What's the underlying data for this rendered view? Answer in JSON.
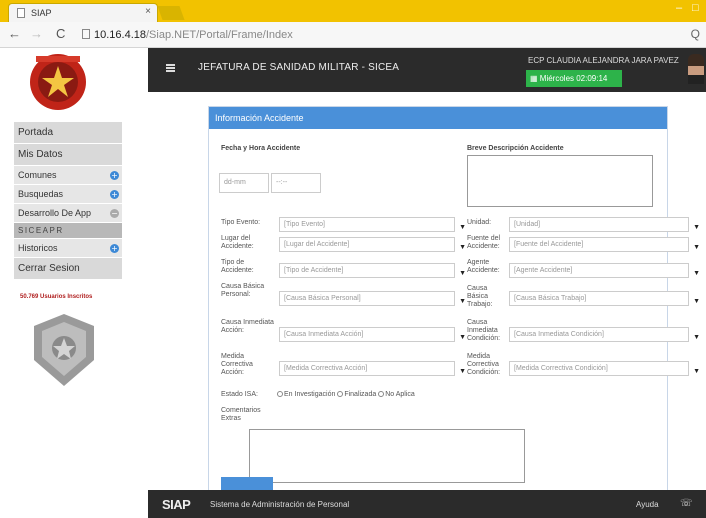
{
  "browser": {
    "tab_title": "SIAP",
    "url_host": "10.16.4.18",
    "url_path": "/Siap.NET/Portal/Frame/Index"
  },
  "header": {
    "title": "JEFATURA DE SANIDAD MILITAR - SICEA",
    "user": "ECP CLAUDIA ALEJANDRA JARA PAVEZ",
    "date": "Miércoles 02:09:14"
  },
  "sidebar": {
    "items": [
      {
        "label": "Portada"
      },
      {
        "label": "Mis Datos"
      },
      {
        "label": "Comunes"
      },
      {
        "label": "Busquedas"
      },
      {
        "label": "Desarrollo De App"
      },
      {
        "label": "SICEAPR"
      },
      {
        "label": "Historicos"
      },
      {
        "label": "Cerrar Sesion"
      }
    ],
    "users_count": "50.769 Usuarios Inscritos"
  },
  "panel": {
    "title": "Información Accidente",
    "date_label": "Fecha y Hora Accidente",
    "desc_label": "Breve Descripción Accidente",
    "date_placeholder": "dd-mm",
    "time_placeholder": "--:--",
    "fields_left": [
      {
        "label": "Tipo Evento:",
        "value": "[Tipo Evento]"
      },
      {
        "label": "Lugar del Accidente:",
        "value": "[Lugar del Accidente]"
      },
      {
        "label": "Tipo de Accidente:",
        "value": "[Tipo de Accidente]"
      },
      {
        "label": "Causa Básica Personal:",
        "value": "[Causa Básica Personal]"
      },
      {
        "label": "Causa Inmediata Acción:",
        "value": "[Causa Inmediata Acción]"
      },
      {
        "label": "Medida Correctiva Acción:",
        "value": "[Medida Correctiva Acción]"
      }
    ],
    "fields_right": [
      {
        "label": "Unidad:",
        "value": "[Unidad]"
      },
      {
        "label": "Fuente del Accidente:",
        "value": "[Fuente del Accidente]"
      },
      {
        "label": "Agente Accidente:",
        "value": "[Agente Accidente]"
      },
      {
        "label": "Causa Básica Trabajo:",
        "value": "[Causa Básica Trabajo]"
      },
      {
        "label": "Causa Inmediata Condición:",
        "value": "[Causa Inmediata Condición]"
      },
      {
        "label": "Medida Correctiva Condición:",
        "value": "[Medida Correctiva Condición]"
      }
    ],
    "estado_label": "Estado ISA:",
    "estado_options": [
      "En Investigación",
      "Finalizada",
      "No Aplica"
    ],
    "comments_label": "Comentarios Extras"
  },
  "footer": {
    "logo": "SIAP",
    "text": "Sistema de Administración de Personal",
    "help": "Ayuda"
  }
}
